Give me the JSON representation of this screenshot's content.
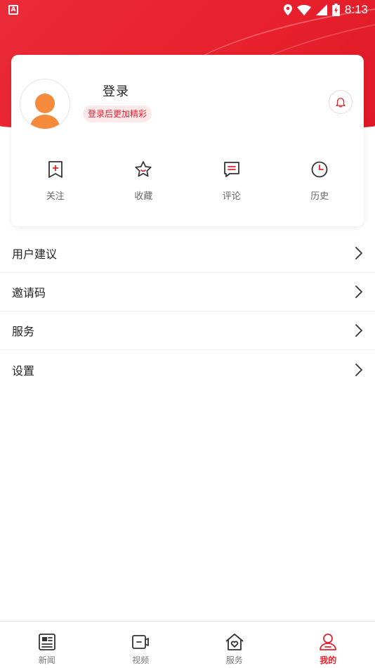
{
  "status_bar": {
    "time": "8:13",
    "app_badge": "A"
  },
  "profile": {
    "login_title": "登录",
    "login_hint": "登录后更加精彩"
  },
  "quick_actions": [
    {
      "label": "关注",
      "icon": "bookmark-plus-icon"
    },
    {
      "label": "收藏",
      "icon": "star-icon"
    },
    {
      "label": "评论",
      "icon": "comment-icon"
    },
    {
      "label": "历史",
      "icon": "clock-icon"
    }
  ],
  "menu": [
    {
      "label": "用户建议"
    },
    {
      "label": "邀请码"
    },
    {
      "label": "服务"
    },
    {
      "label": "设置"
    }
  ],
  "bottom_nav": [
    {
      "label": "新闻",
      "icon": "newspaper-icon",
      "active": false
    },
    {
      "label": "视频",
      "icon": "video-icon",
      "active": false
    },
    {
      "label": "服务",
      "icon": "home-heart-icon",
      "active": false
    },
    {
      "label": "我的",
      "icon": "user-icon",
      "active": true
    }
  ],
  "colors": {
    "accent": "#e8202d",
    "badge_bg": "#fde8ea",
    "avatar_orange": "#f58a3c"
  }
}
